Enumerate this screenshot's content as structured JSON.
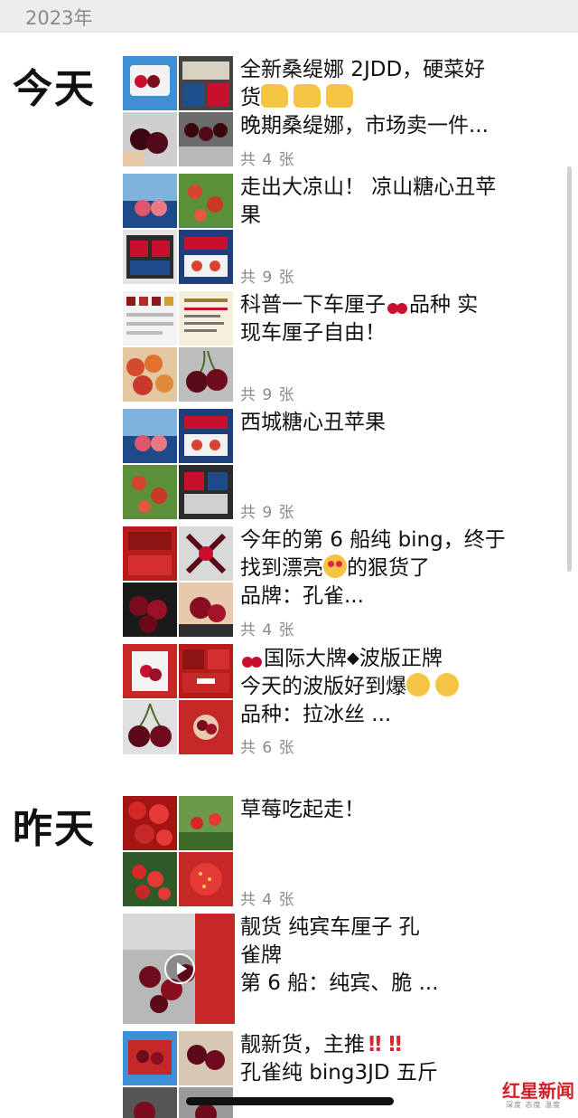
{
  "year_header": "2023年",
  "days": [
    {
      "label": "今天",
      "posts": [
        {
          "lines": [
            "全新桑缇娜 2JDD，硬菜好",
            "货",
            "晚期桑缇娜，市场卖一件..."
          ],
          "count": "共 4 张"
        },
        {
          "lines": [
            "走出大凉山！ 凉山糖心丑苹",
            "果"
          ],
          "count": "共 9 张"
        },
        {
          "lines": [
            "科普一下车厘子",
            "品种   实",
            "现车厘子自由！"
          ],
          "count": "共 9 张"
        },
        {
          "lines": [
            "西城糖心丑苹果"
          ],
          "count": "共 9 张"
        },
        {
          "lines": [
            "今年的第 6 船纯 bing，终于",
            "找到漂亮",
            "的狠货了",
            "品牌：孔雀..."
          ],
          "count": "共 4 张"
        },
        {
          "lines": [
            "国际大牌",
            "波版正牌",
            "今天的波版好到爆",
            "品种：拉冰丝 ..."
          ],
          "count": "共 6 张"
        }
      ]
    },
    {
      "label": "昨天",
      "posts": [
        {
          "lines": [
            "草莓吃起走！"
          ],
          "count": "共 4 张"
        },
        {
          "lines": [
            "靓货  纯宾车厘子 孔",
            "雀牌",
            "第 6 船：纯宾、脆 ..."
          ],
          "count": ""
        },
        {
          "lines": [
            "靓新货，主推",
            "孔雀纯 bing3JD 五斤"
          ],
          "count": ""
        }
      ]
    }
  ],
  "icons": {
    "thumbs_up": "thumbs-up-icon",
    "cherry": "cherry-icon",
    "heart_eyes": "heart-eyes-icon",
    "clap": "clapping-hands-icon",
    "double_exclamation": "double-exclamation-icon",
    "diamond": "black-diamond-icon",
    "play": "play-icon"
  },
  "symbols": {
    "diamond": "◆",
    "double_exclamation": "‼"
  },
  "watermark": {
    "main": "红星新闻",
    "sub": "深度 态度 温度"
  },
  "colors": {
    "accent_red": "#c8102e",
    "meta_gray": "#8a8a8a",
    "header_bg": "#ededed"
  }
}
